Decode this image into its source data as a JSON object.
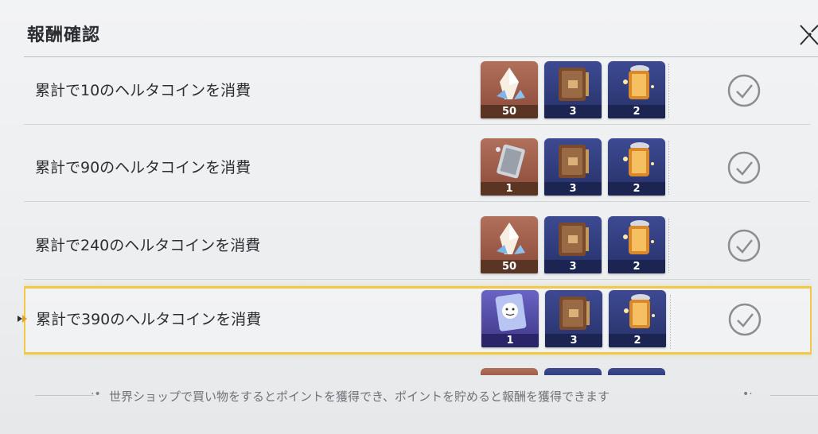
{
  "header": {
    "title": "報酬確認"
  },
  "rows": [
    {
      "label": "累計で10のヘルタコインを消費",
      "items": [
        {
          "icon": "crystal-icon",
          "count": "50",
          "theme": "brown"
        },
        {
          "icon": "book-icon",
          "count": "3",
          "theme": "blue"
        },
        {
          "icon": "lantern-icon",
          "count": "2",
          "theme": "blue"
        }
      ],
      "claimed": true
    },
    {
      "label": "累計で90のヘルタコインを消費",
      "items": [
        {
          "icon": "card-icon",
          "count": "1",
          "theme": "brown"
        },
        {
          "icon": "book-icon",
          "count": "3",
          "theme": "blue"
        },
        {
          "icon": "lantern-icon",
          "count": "2",
          "theme": "blue"
        }
      ],
      "claimed": true
    },
    {
      "label": "累計で240のヘルタコインを消費",
      "items": [
        {
          "icon": "crystal-icon",
          "count": "50",
          "theme": "brown"
        },
        {
          "icon": "book-icon",
          "count": "3",
          "theme": "blue"
        },
        {
          "icon": "lantern-icon",
          "count": "2",
          "theme": "blue"
        }
      ],
      "claimed": true
    },
    {
      "label": "累計で390のヘルタコインを消費",
      "items": [
        {
          "icon": "character-card-icon",
          "count": "1",
          "theme": "purple"
        },
        {
          "icon": "book-icon",
          "count": "3",
          "theme": "blue"
        },
        {
          "icon": "lantern-icon",
          "count": "2",
          "theme": "blue"
        }
      ],
      "claimed": true,
      "selected": true
    }
  ],
  "footer": {
    "text": "世界ショップで買い物をするとポイントを獲得でき、ポイントを貯めると報酬を獲得できます"
  },
  "colors": {
    "highlight": "#f2c84b",
    "claimed_check": "#8a8d92"
  }
}
